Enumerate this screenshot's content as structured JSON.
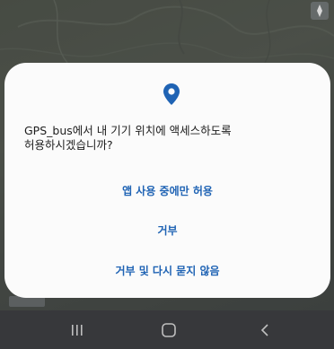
{
  "background": {
    "map_control_icon": "compass-icon"
  },
  "dialog": {
    "icon": "location-pin-icon",
    "message_line1": "GPS_bus에서 내 기기 위치에 액세스하도록",
    "message_line2": "허용하시겠습니까?",
    "options": [
      "앱 사용 중에만 허용",
      "거부",
      "거부 및 다시 묻지 않음"
    ],
    "accent_color": "#1f63b4"
  },
  "navbar": {
    "icons": [
      "recent-apps-icon",
      "home-icon",
      "back-icon"
    ]
  }
}
